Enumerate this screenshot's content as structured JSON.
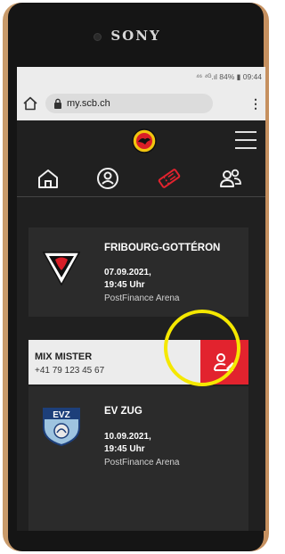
{
  "device": {
    "brand": "SONY"
  },
  "status_bar": {
    "text": "⁴⁶ ⁴ᴳ.ıl 84% ▮ 09:44"
  },
  "browser": {
    "url": "my.scb.ch",
    "menu_glyph": "⋮"
  },
  "nav": {
    "items": [
      "home-icon",
      "profile-icon",
      "tickets-icon",
      "community-icon"
    ],
    "active": "tickets-icon"
  },
  "games": [
    {
      "team": "FRIBOURG-GOTTÉRON",
      "date": "07.09.2021,",
      "time": "19:45 Uhr",
      "arena": "PostFinance Arena"
    },
    {
      "team": "EV ZUG",
      "date": "10.09.2021,",
      "time": "19:45 Uhr",
      "arena": "PostFinance Arena"
    }
  ],
  "contact": {
    "name": "MIX MISTER",
    "phone": "+41 79 123 45 67"
  },
  "colors": {
    "accent": "#e2232e",
    "highlight": "#f5e800",
    "dark": "#202020",
    "card": "#2b2b2b"
  }
}
